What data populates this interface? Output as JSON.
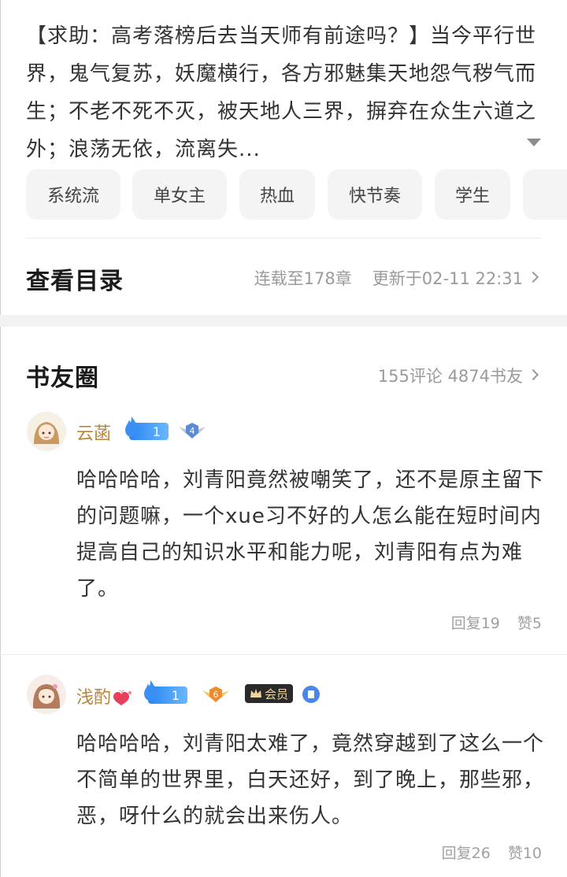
{
  "book": {
    "description": "【求助：高考落榜后去当天师有前途吗？】当今平行世界，鬼气复苏，妖魔横行，各方邪魅集天地怨气秽气而生；不老不死不灭，被天地人三界，摒弃在众生六道之外；浪荡无依，流离失...",
    "tags": [
      "系统流",
      "单女主",
      "热血",
      "快节奏",
      "学生"
    ]
  },
  "catalog": {
    "title": "查看目录",
    "serial_status": "连载至178章",
    "updated": "更新于02-11 22:31"
  },
  "circle": {
    "title": "书友圈",
    "stats": "155评论 4874书友"
  },
  "comments": [
    {
      "username": "云菡",
      "fan_level": "1",
      "wing_level": "4",
      "text": "哈哈哈哈，刘青阳竟然被嘲笑了，还不是原主留下的问题嘛，一个xue习不好的人怎么能在短时间内提高自己的知识水平和能力呢，刘青阳有点为难了。",
      "replies": "回复19",
      "likes": "赞5"
    },
    {
      "username": "浅酌",
      "fan_level": "1",
      "wing_level": "6",
      "vip_label": "会员",
      "text": "哈哈哈哈，刘青阳太难了，竟然穿越到了这么一个不简单的世界里，白天还好，到了晚上，那些邪，恶，呀什么的就会出来伤人。",
      "replies": "回复26",
      "likes": "赞10"
    }
  ],
  "colors": {
    "accent_blue": "#2a86f0",
    "username": "#b8863a",
    "muted": "#9a9a9a"
  }
}
